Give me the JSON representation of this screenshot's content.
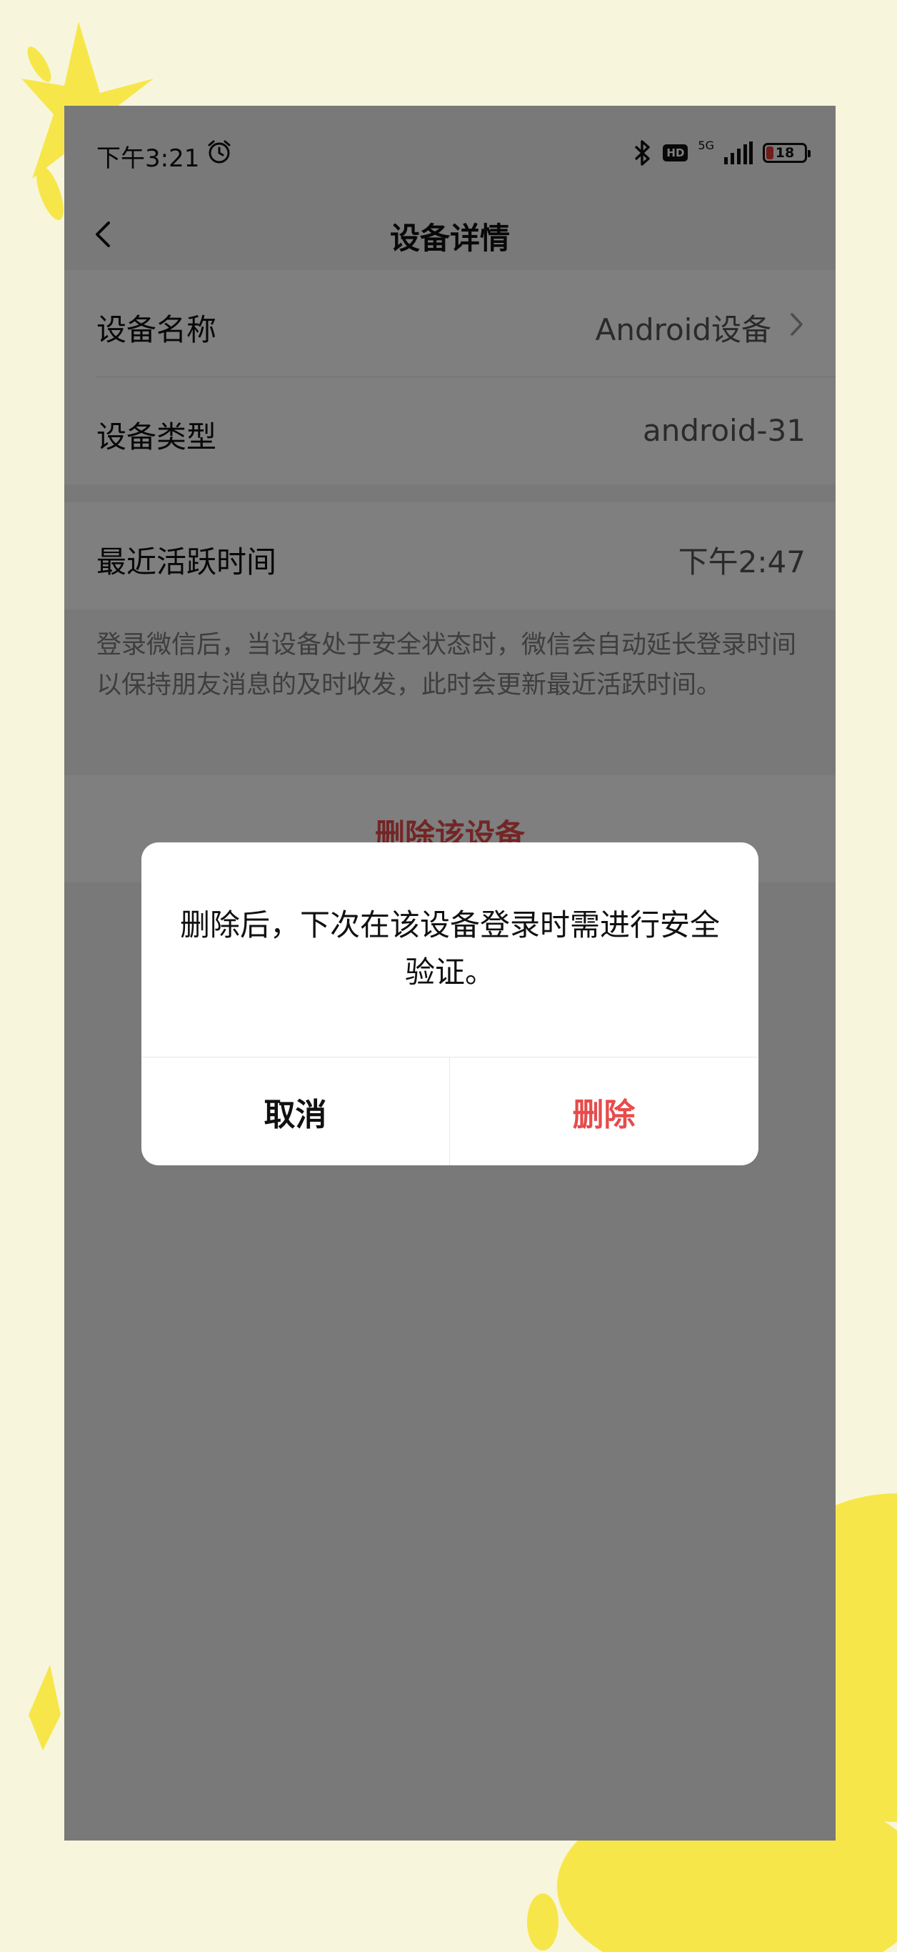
{
  "status_bar": {
    "time": "下午3:21",
    "hd": "HD",
    "network": "5G",
    "battery": "18",
    "battery_level": 0.18
  },
  "navbar": {
    "title": "设备详情",
    "back_icon": "chevron-left-icon"
  },
  "device_info": [
    {
      "label": "设备名称",
      "value": "Android设备",
      "has_chevron": true
    },
    {
      "label": "设备类型",
      "value": "android-31",
      "has_chevron": false
    }
  ],
  "activity": {
    "label": "最近活跃时间",
    "value": "下午2:47",
    "description": "登录微信后，当设备处于安全状态时，微信会自动延长登录时间以保持朋友消息的及时收发，此时会更新最近活跃时间。"
  },
  "delete_action": {
    "label": "删除该设备"
  },
  "dialog": {
    "message": "删除后，下次在该设备登录时需进行安全验证。",
    "cancel_label": "取消",
    "delete_label": "删除"
  },
  "colors": {
    "danger": "#e74b4b",
    "background": "#f7f6dc",
    "overlay": "rgba(0,0,0,0.5)"
  }
}
